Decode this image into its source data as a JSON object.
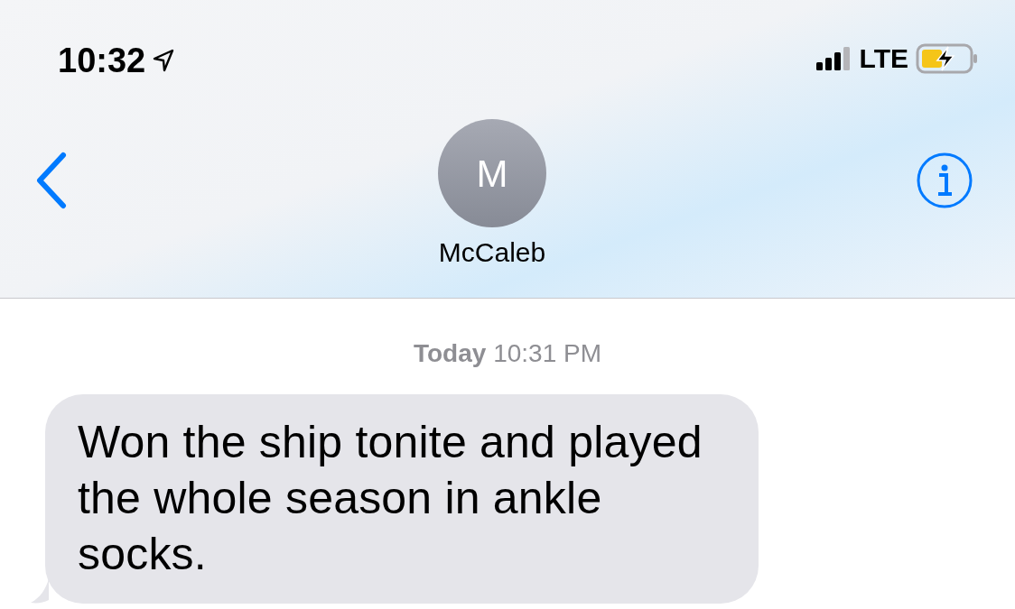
{
  "status_bar": {
    "time": "10:32",
    "network": "LTE"
  },
  "header": {
    "avatar_initial": "M",
    "contact_name": "McCaleb"
  },
  "timestamp": "**Today** 10:31 PM",
  "messages": [
    {
      "kind": "received",
      "text": "Won the ship tonite and played the whole season in ankle socks."
    }
  ]
}
